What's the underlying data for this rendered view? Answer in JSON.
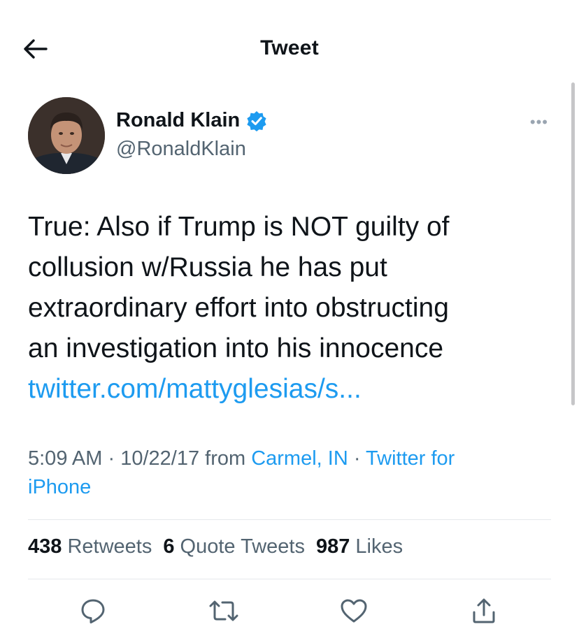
{
  "header": {
    "title": "Tweet"
  },
  "author": {
    "name": "Ronald Klain",
    "handle": "@RonaldKlain",
    "verified": true
  },
  "tweet": {
    "lines": [
      "True: Also if Trump is NOT guilty of",
      "collusion w/Russia he has put",
      "extraordinary effort into obstructing",
      "an investigation into his innocence"
    ],
    "link": "twitter.com/mattyglesias/s..."
  },
  "meta": {
    "time": "5:09 AM",
    "date": "10/22/17",
    "from_label": "from",
    "location": "Carmel, IN",
    "source_part1": "Twitter for",
    "source_part2": "iPhone"
  },
  "stats": {
    "retweets_count": "438",
    "retweets_label": "Retweets",
    "quotes_count": "6",
    "quotes_label": "Quote Tweets",
    "likes_count": "987",
    "likes_label": "Likes"
  },
  "colors": {
    "accent": "#1d9bf0",
    "text": "#0f1419",
    "muted": "#536471"
  },
  "icons": [
    "back-arrow-icon",
    "verified-badge-icon",
    "more-icon",
    "reply-icon",
    "retweet-icon",
    "like-icon",
    "share-icon"
  ]
}
